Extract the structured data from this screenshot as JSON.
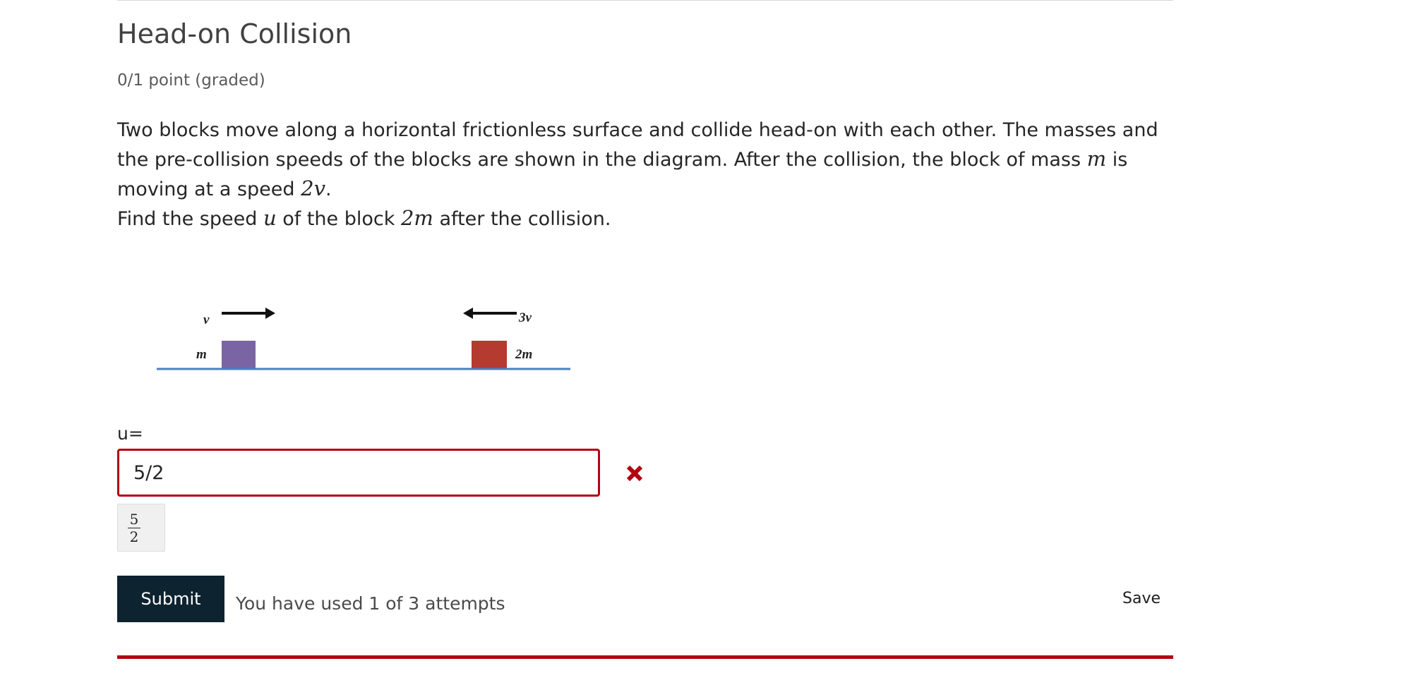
{
  "problem": {
    "title": "Head-on Collision",
    "points": "0/1 point (graded)",
    "text": {
      "line1": "Two blocks move along a horizontal frictionless surface and collide head-on with each other. The masses and the pre-collision speeds of the blocks are shown in the diagram. After the collision, the block of mass ",
      "mass_symbol": "m",
      "line1_tail": " is moving at a speed ",
      "speed_symbol": "2v",
      "line1_end": ".",
      "line2_start": "Find the speed ",
      "unknown_symbol": "u",
      "line2_mid": " of the block ",
      "block_symbol": "2m",
      "line2_end": " after the collision."
    }
  },
  "diagram": {
    "left_velocity_label": "v",
    "right_velocity_label": "3v",
    "left_mass_label": "m",
    "right_mass_label": "2m",
    "left_block_color": "#7b64a3",
    "right_block_color": "#b53a2f",
    "surface_color": "#4a7fc4"
  },
  "answer": {
    "label": "u=",
    "value": "5/2",
    "status": "incorrect",
    "status_icon": "cross-icon",
    "status_color": "#b20610",
    "preview": {
      "numerator": "5",
      "denominator": "2"
    }
  },
  "actions": {
    "submit_label": "Submit",
    "attempts_text": "You have used 1 of 3 attempts",
    "save_label": "Save"
  },
  "colors": {
    "submit_background": "#0e2330",
    "error_border": "#b20610"
  }
}
